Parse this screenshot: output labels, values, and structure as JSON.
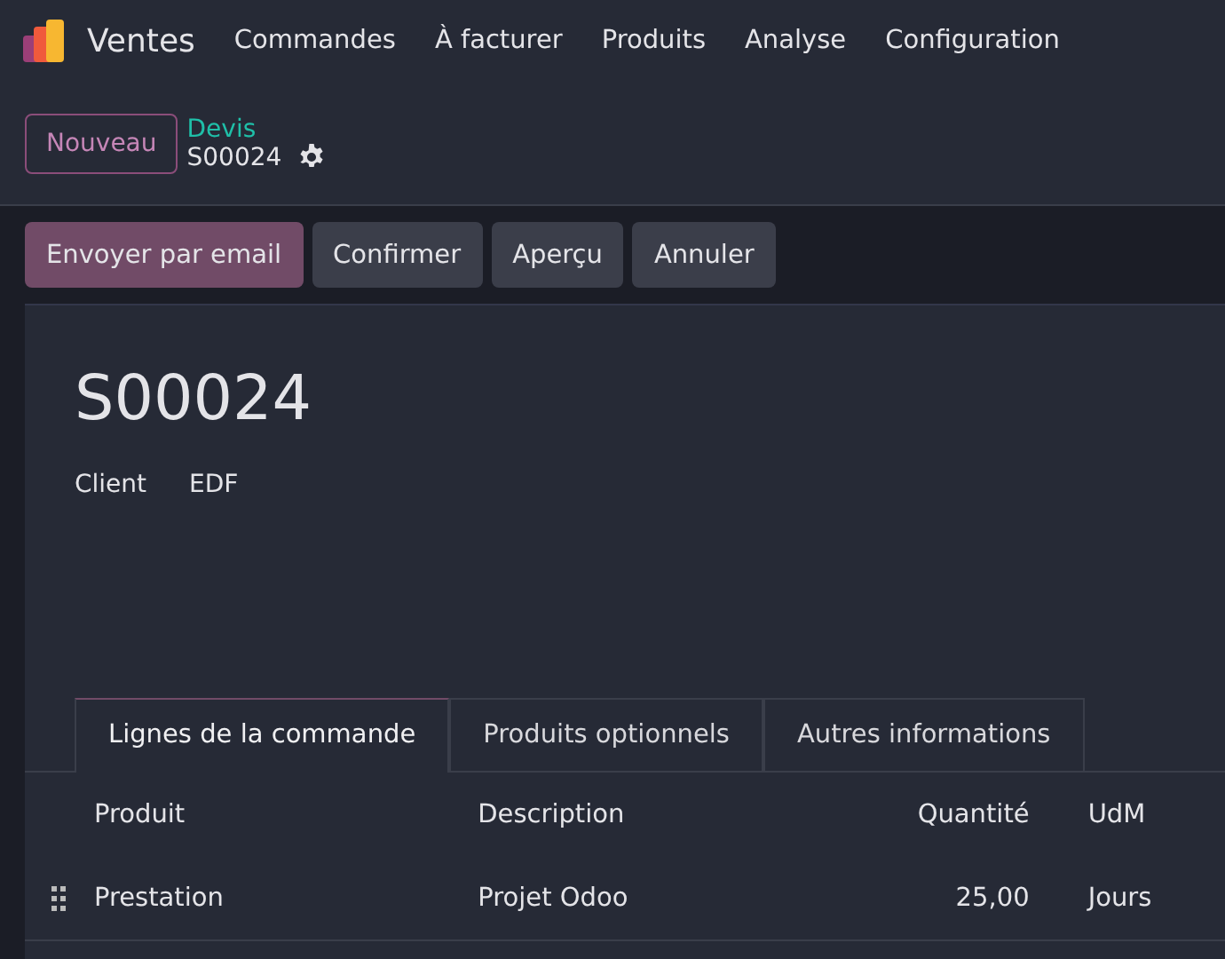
{
  "nav": {
    "app": "Ventes",
    "menu": [
      "Commandes",
      "À facturer",
      "Produits",
      "Analyse",
      "Configuration"
    ]
  },
  "control": {
    "new_button": "Nouveau",
    "breadcrumb": "Devis",
    "record": "S00024"
  },
  "actions": [
    {
      "label": "Envoyer par email",
      "kind": "primary"
    },
    {
      "label": "Confirmer",
      "kind": "secondary"
    },
    {
      "label": "Aperçu",
      "kind": "secondary"
    },
    {
      "label": "Annuler",
      "kind": "secondary"
    }
  ],
  "sheet": {
    "title": "S00024",
    "fields": [
      {
        "label": "Client",
        "value": "EDF"
      }
    ],
    "tabs": [
      {
        "label": "Lignes de la commande",
        "selected": true
      },
      {
        "label": "Produits optionnels",
        "selected": false
      },
      {
        "label": "Autres informations",
        "selected": false
      }
    ],
    "table": {
      "columns": [
        "Produit",
        "Description",
        "Quantité",
        "UdM"
      ],
      "rows": [
        [
          "Prestation",
          "Projet Odoo",
          "25,00",
          "Jours"
        ]
      ]
    }
  }
}
